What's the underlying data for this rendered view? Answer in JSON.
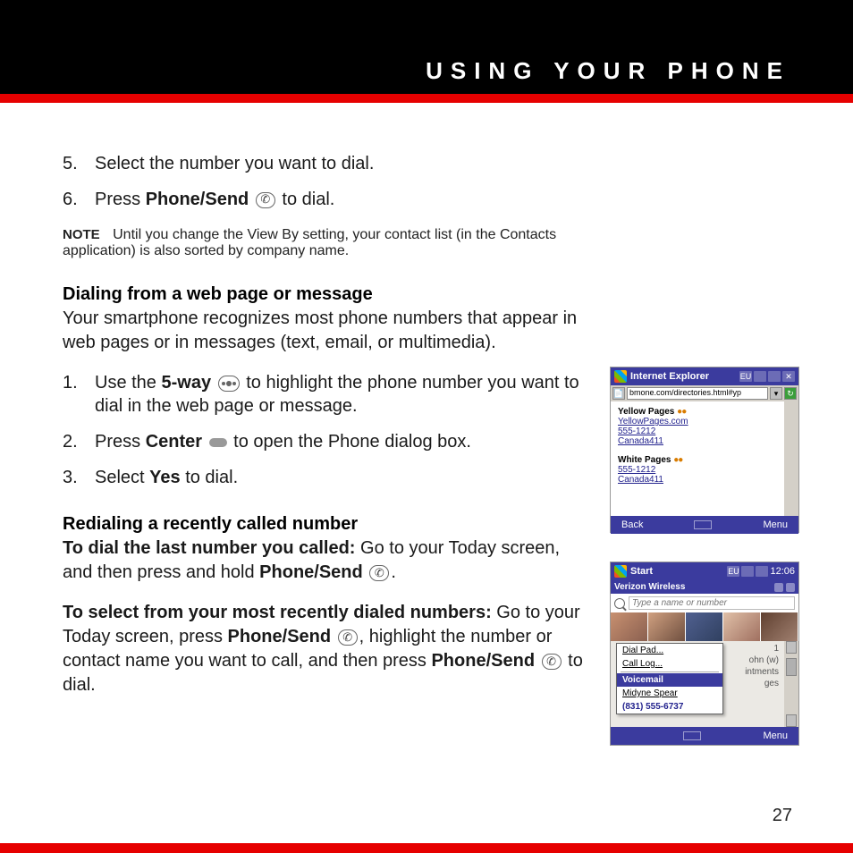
{
  "header": {
    "title": "USING YOUR PHONE"
  },
  "page_number": "27",
  "steps_initial": [
    {
      "num": "5.",
      "pre": "Select the number you want to dial."
    },
    {
      "num": "6.",
      "pre": "Press ",
      "bold1": "Phone/Send",
      "icon": "phone",
      "post": " to dial."
    }
  ],
  "note": {
    "label": "NOTE",
    "text": "Until you change the View By setting, your contact list (in the Contacts application) is also sorted by company name."
  },
  "section1": {
    "heading": "Dialing from a web page or message",
    "body": "Your smartphone recognizes most phone numbers that appear in web pages or in messages (text, email, or multimedia).",
    "steps": [
      {
        "num": "1.",
        "pre": "Use the ",
        "bold1": "5-way",
        "icon": "5way",
        "post": " to highlight the phone number you want to dial in the web page or message."
      },
      {
        "num": "2.",
        "pre": "Press ",
        "bold1": "Center",
        "icon": "center",
        "post": " to open the Phone dialog box."
      },
      {
        "num": "3.",
        "pre": "Select ",
        "bold1": "Yes",
        "post": " to dial."
      }
    ]
  },
  "section2": {
    "heading": "Redialing a recently called number",
    "para1": {
      "lead": "To dial the last number you called:",
      "rest_pre": " Go to your Today screen, and then press and hold ",
      "bold1": "Phone/Send",
      "post": "."
    },
    "para2": {
      "lead": "To select from your most recently dialed numbers:",
      "rest_pre": " Go to your Today screen, press ",
      "bold1": "Phone/Send",
      "mid1": ", highlight the number or contact name you want to call, and then press ",
      "bold2": "Phone/Send",
      "post": " to dial."
    }
  },
  "screenshot1": {
    "title": "Internet Explorer",
    "title_icons": [
      "EU",
      "📶",
      "🔈",
      "✕"
    ],
    "url": "bmone.com/directories.html#yp",
    "yellow_head": "Yellow Pages",
    "yellow_links": [
      "YellowPages.com",
      "555-1212",
      "Canada411"
    ],
    "white_head": "White Pages",
    "white_links": [
      "555-1212",
      "Canada411"
    ],
    "footer_left": "Back",
    "footer_right": "Menu"
  },
  "screenshot2": {
    "title": "Start",
    "title_icons": [
      "EU",
      "📶",
      "🔈"
    ],
    "clock": "12:06",
    "carrier": "Verizon Wireless",
    "input_placeholder": "Type a name or number",
    "bg_rows": [
      {
        "l": "Voicemail",
        "r": "1"
      },
      {
        "l": "",
        "r": "ohn (w)"
      },
      {
        "l": "",
        "r": "intments"
      },
      {
        "l": "",
        "r": "ges"
      }
    ],
    "popup": {
      "items": [
        "Dial Pad...",
        "Call Log..."
      ],
      "selected": "Voicemail",
      "below1": "Midyne Spear",
      "below2": "(831) 555-6737"
    },
    "footer_right": "Menu"
  }
}
